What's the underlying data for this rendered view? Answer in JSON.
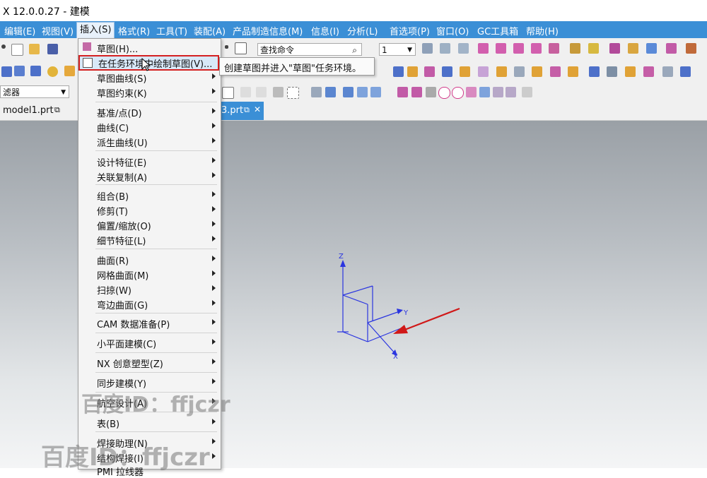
{
  "window": {
    "title": "X 12.0.0.27 - 建模"
  },
  "menubar": {
    "items": [
      {
        "label": "编辑(E)"
      },
      {
        "label": "视图(V)"
      },
      {
        "label": "插入(S)"
      },
      {
        "label": "格式(R)"
      },
      {
        "label": "工具(T)"
      },
      {
        "label": "装配(A)"
      },
      {
        "label": "产品制造信息(M)"
      },
      {
        "label": "信息(I)"
      },
      {
        "label": "分析(L)"
      },
      {
        "label": "首选项(P)"
      },
      {
        "label": "窗口(O)"
      },
      {
        "label": "GC工具箱"
      },
      {
        "label": "帮助(H)"
      }
    ]
  },
  "toolbar": {
    "command_search_placeholder": "查找命令",
    "view_count_value": "1",
    "selection_filter_label": "滤器"
  },
  "tabs": [
    {
      "label": "model1.prt"
    },
    {
      "label": "3.prt"
    }
  ],
  "insert_menu": {
    "items": [
      {
        "label": "草图(H)...",
        "submenu": false
      },
      {
        "label": "在任务环境中绘制草图(V)...",
        "submenu": false,
        "highlighted": true
      },
      {
        "label": "草图曲线(S)",
        "submenu": true
      },
      {
        "label": "草图约束(K)",
        "submenu": true
      },
      {
        "label": "基准/点(D)",
        "submenu": true
      },
      {
        "label": "曲线(C)",
        "submenu": true
      },
      {
        "label": "派生曲线(U)",
        "submenu": true
      },
      {
        "label": "设计特征(E)",
        "submenu": true
      },
      {
        "label": "关联复制(A)",
        "submenu": true
      },
      {
        "label": "组合(B)",
        "submenu": true
      },
      {
        "label": "修剪(T)",
        "submenu": true
      },
      {
        "label": "偏置/缩放(O)",
        "submenu": true
      },
      {
        "label": "细节特征(L)",
        "submenu": true
      },
      {
        "label": "曲面(R)",
        "submenu": true
      },
      {
        "label": "网格曲面(M)",
        "submenu": true
      },
      {
        "label": "扫掠(W)",
        "submenu": true
      },
      {
        "label": "弯边曲面(G)",
        "submenu": true
      },
      {
        "label": "CAM 数据准备(P)",
        "submenu": true
      },
      {
        "label": "小平面建模(C)",
        "submenu": true
      },
      {
        "label": "NX 创意塑型(Z)",
        "submenu": true
      },
      {
        "label": "同步建模(Y)",
        "submenu": true
      },
      {
        "label": "航空设计(A)",
        "submenu": true
      },
      {
        "label": "表(B)",
        "submenu": true
      },
      {
        "label": "焊接助理(N)",
        "submenu": true
      },
      {
        "label": "结构焊接(I)",
        "submenu": true
      },
      {
        "label": "PMI 拉线器",
        "submenu": false
      }
    ]
  },
  "tooltip": {
    "text": "创建草图并进入\"草图\"任务环境。"
  },
  "triad": {
    "x_label": "X",
    "y_label": "Y",
    "z_label": "Z"
  },
  "watermarks": [
    {
      "text": "百度ID：ffjczr"
    },
    {
      "text": "百度ID：ffjczr"
    }
  ],
  "colors": {
    "menubar": "#3b8fd6",
    "highlight_border": "#d42020",
    "triad": "#2a35e0",
    "arrow": "#d01818"
  }
}
